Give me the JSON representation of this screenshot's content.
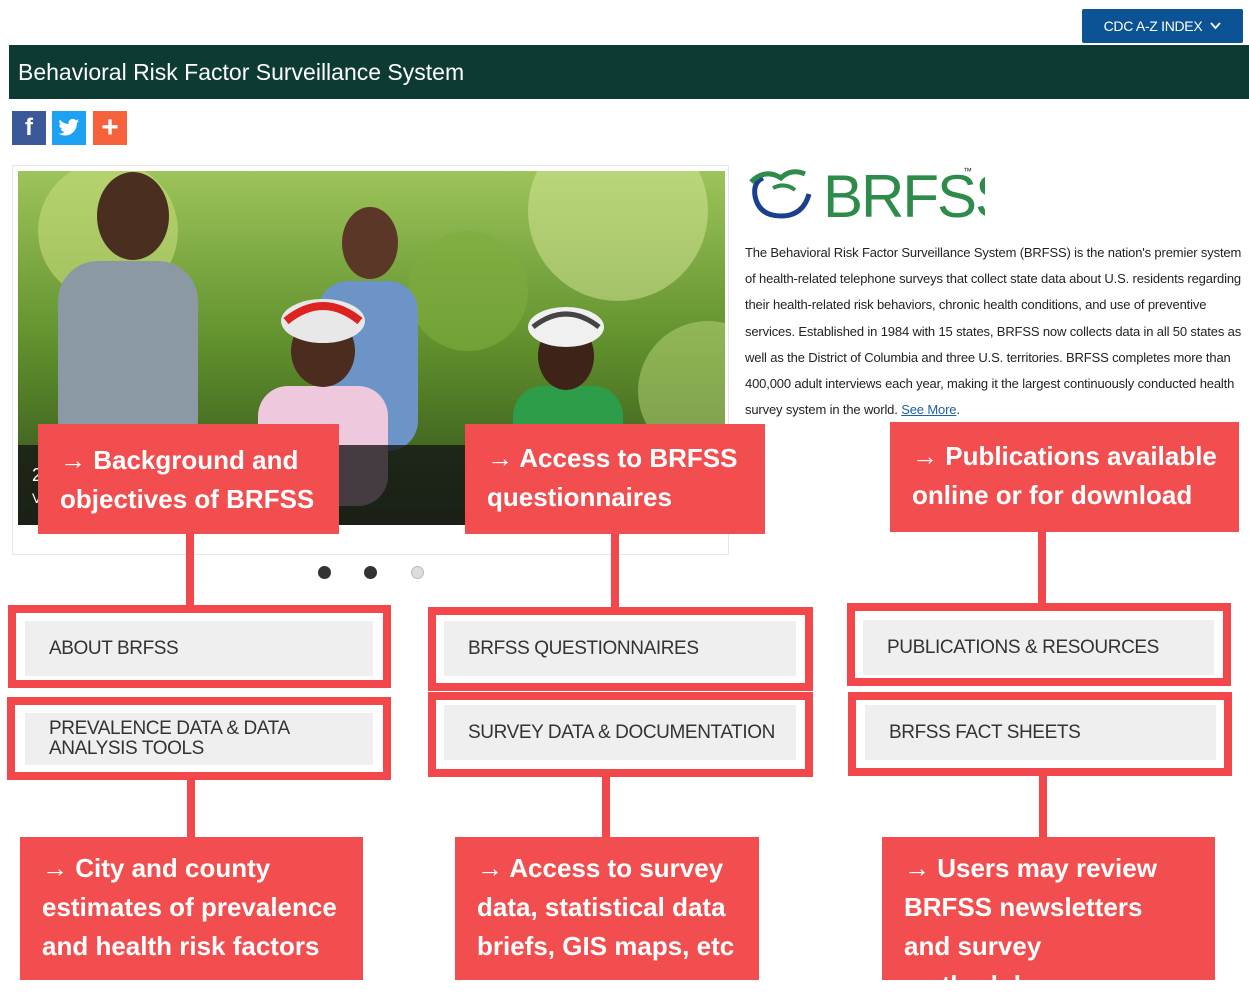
{
  "top_nav": {
    "az_index_label": "CDC A-Z INDEX"
  },
  "header": {
    "title": "Behavioral Risk Factor Surveillance System"
  },
  "social": {
    "facebook": "f",
    "twitter": "twitter-icon",
    "share": "+"
  },
  "carousel": {
    "caption_line1": "2",
    "caption_line2": "V",
    "slide_count": 3,
    "active_slide": 2
  },
  "logo": {
    "text": "BRFSS",
    "tm": "™"
  },
  "intro": {
    "text": "The Behavioral Risk Factor Surveillance System (BRFSS) is the nation's premier system of health-related telephone surveys that collect state data about U.S. residents regarding their health-related risk behaviors, chronic health conditions, and use of preventive services. Established in 1984 with 15 states, BRFSS now collects data in all 50 states as well as the District of Columbia and three U.S. territories. BRFSS completes more than 400,000 adult interviews each year, making it the largest continuously conducted health survey system in the world.",
    "see_more": "See More",
    "period": "."
  },
  "tiles": {
    "about": "ABOUT BRFSS",
    "questionnaires": "BRFSS QUESTIONNAIRES",
    "publications": "PUBLICATIONS & RESOURCES",
    "prevalence": "PREVALENCE DATA & DATA ANALYSIS TOOLS",
    "survey_data": "SURVEY DATA & DOCUMENTATION",
    "fact_sheets": "BRFSS FACT SHEETS"
  },
  "callouts": {
    "background": "→ Background and objectives of BRFSS",
    "questionnaires": "→ Access to BRFSS questionnaires",
    "publications": "→ Publications available online or for download",
    "city_county": "→ City and county estimates of prevalence and health risk factors",
    "survey_data": "→ Access to survey data, statistical data briefs, GIS maps, etc",
    "newsletters": "→ Users may review BRFSS newsletters and survey methodology"
  },
  "colors": {
    "header_bg": "#0d3a33",
    "az_button": "#0b5394",
    "callout": "#f24e4f",
    "tile_bg": "#efefef",
    "logo_green": "#2e8b4a",
    "logo_navy": "#1a3f8f"
  }
}
